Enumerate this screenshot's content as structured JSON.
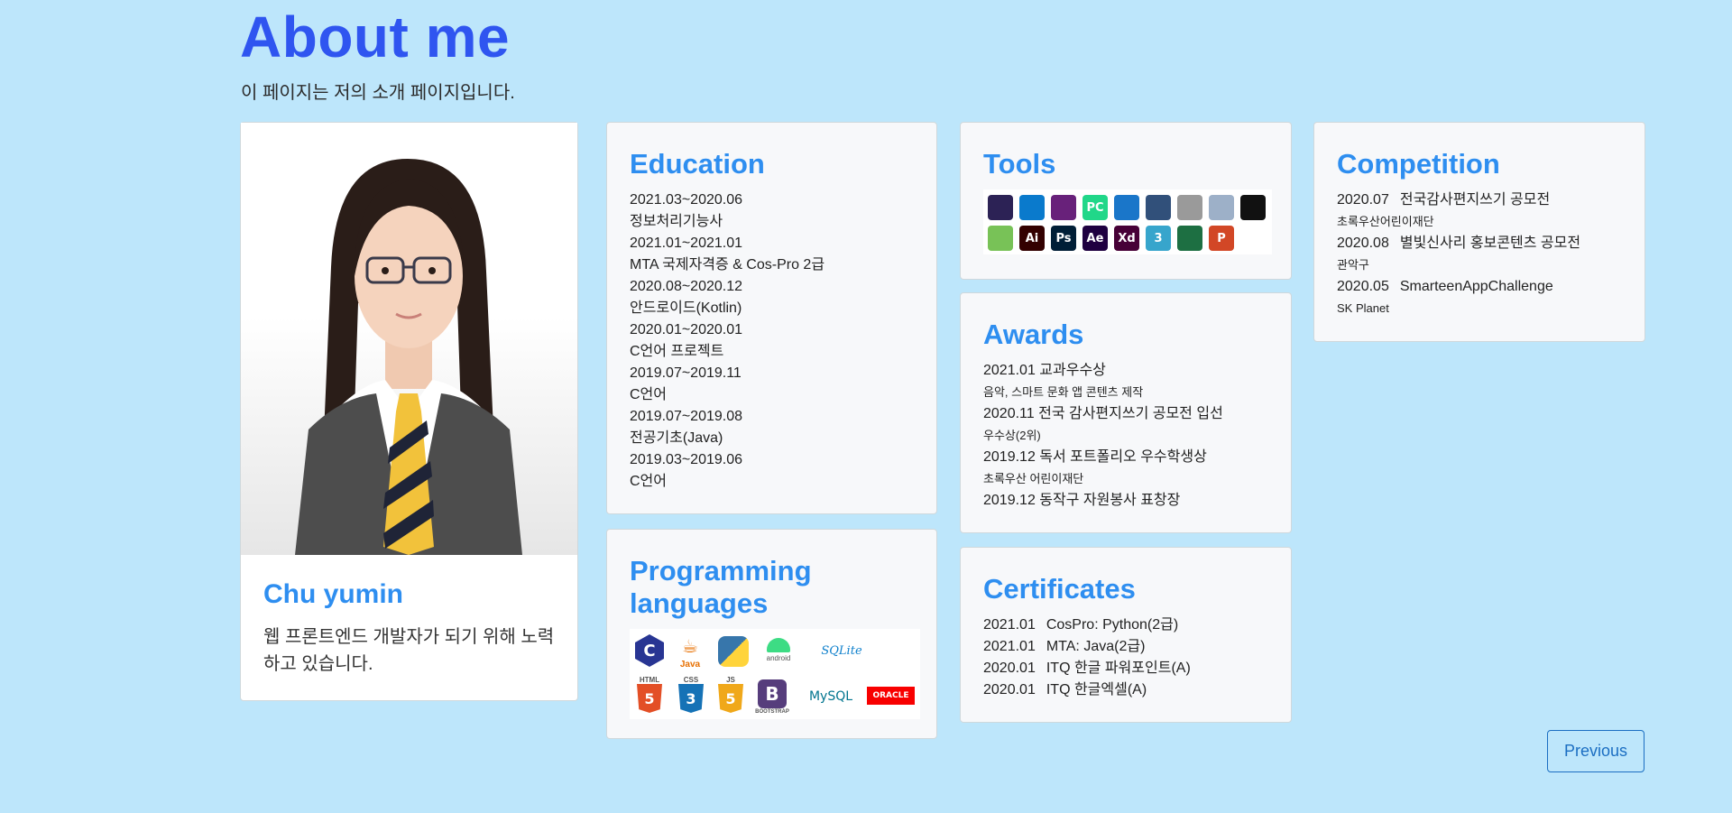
{
  "header": {
    "title": "About me",
    "subtitle": "이 페이지는 저의 소개 페이지입니다."
  },
  "profile": {
    "name": "Chu yumin",
    "description": "웹 프론트엔드 개발자가 되기 위해 노력하고 있습니다."
  },
  "education": {
    "title": "Education",
    "items": [
      "2021.03~2020.06",
      "정보처리기능사",
      "2021.01~2021.01",
      "MTA 국제자격증 & Cos-Pro 2급",
      "2020.08~2020.12",
      "안드로이드(Kotlin)",
      "2020.01~2020.01",
      "C언어 프로젝트",
      "2019.07~2019.11",
      "C언어",
      "2019.07~2019.08",
      "전공기초(Java)",
      "2019.03~2019.06",
      "C언어"
    ]
  },
  "programming": {
    "title": "Programming languages",
    "icons": [
      "c-icon",
      "java-icon",
      "python-icon",
      "android-icon",
      "sqlite-icon",
      "html-icon",
      "css-icon",
      "js-icon",
      "bootstrap-icon",
      "mysql-icon",
      "oracle-icon"
    ],
    "labels": {
      "java": "Java",
      "android": "android",
      "sqlite": "SQLite",
      "html": "HTML",
      "css": "CSS",
      "js": "JS",
      "bootstrap": "BOOTSTRAP",
      "mysql": "MySQL",
      "oracle": "ORACLE",
      "c": "C",
      "html_num": "5",
      "css_num": "3",
      "js_num": "5",
      "b": "B"
    }
  },
  "tools": {
    "title": "Tools",
    "icons": [
      {
        "name": "eclipse-icon",
        "glyph": "",
        "color": "#2c2255"
      },
      {
        "name": "vscode-icon",
        "glyph": "",
        "color": "#0a7acc"
      },
      {
        "name": "visual-studio-icon",
        "glyph": "",
        "color": "#68217a"
      },
      {
        "name": "pycharm-icon",
        "glyph": "PC",
        "color": "#21d789"
      },
      {
        "name": "dev-icon",
        "glyph": "",
        "color": "#1a76c9"
      },
      {
        "name": "sql-developer-icon",
        "glyph": "",
        "color": "#31507a"
      },
      {
        "name": "database-icon",
        "glyph": "",
        "color": "#9a9a9a"
      },
      {
        "name": "database-add-icon",
        "glyph": "",
        "color": "#9db0c8"
      },
      {
        "name": "github-icon",
        "glyph": "",
        "color": "#111111"
      },
      {
        "name": "android-studio-icon",
        "glyph": "",
        "color": "#78c257"
      },
      {
        "name": "illustrator-icon",
        "glyph": "Ai",
        "color": "#330000"
      },
      {
        "name": "photoshop-icon",
        "glyph": "Ps",
        "color": "#001e36"
      },
      {
        "name": "after-effects-icon",
        "glyph": "Ae",
        "color": "#1f0040"
      },
      {
        "name": "xd-icon",
        "glyph": "Xd",
        "color": "#470137"
      },
      {
        "name": "3dsmax-icon",
        "glyph": "3",
        "color": "#37a5cc"
      },
      {
        "name": "excel-icon",
        "glyph": "",
        "color": "#1d6f42"
      },
      {
        "name": "powerpoint-icon",
        "glyph": "P",
        "color": "#d24726"
      }
    ]
  },
  "awards": {
    "title": "Awards",
    "items": [
      {
        "text": "2021.01 교과우수상",
        "small": false
      },
      {
        "text": "음악, 스마트 문화 앱 콘텐츠 제작",
        "small": true
      },
      {
        "text": "2020.11 전국 감사편지쓰기 공모전 입선",
        "small": false
      },
      {
        "text": "우수상(2위)",
        "small": true
      },
      {
        "text": "2019.12 독서 포트폴리오 우수학생상",
        "small": false
      },
      {
        "text": "초록우산 어린이재단",
        "small": true
      },
      {
        "text": "2019.12 동작구 자원봉사 표창장",
        "small": false
      }
    ]
  },
  "certificates": {
    "title": "Certificates",
    "items": [
      {
        "date": "2021.01",
        "name": "CosPro: Python(2급)"
      },
      {
        "date": "2021.01",
        "name": "MTA: Java(2급)"
      },
      {
        "date": "2020.01",
        "name": "ITQ 한글 파워포인트(A)"
      },
      {
        "date": "2020.01",
        "name": "ITQ 한글엑셀(A)"
      }
    ]
  },
  "competition": {
    "title": "Competition",
    "items": [
      {
        "date": "2020.07",
        "name": "전국감사편지쓰기 공모전",
        "org": "초록우산어린이재단"
      },
      {
        "date": "2020.08",
        "name": "별빛신사리 홍보콘텐츠 공모전",
        "org": "관악구"
      },
      {
        "date": "2020.05",
        "name": "SmarteenAppChallenge",
        "org": "SK Planet"
      }
    ]
  },
  "nav": {
    "previous_label": "Previous"
  }
}
